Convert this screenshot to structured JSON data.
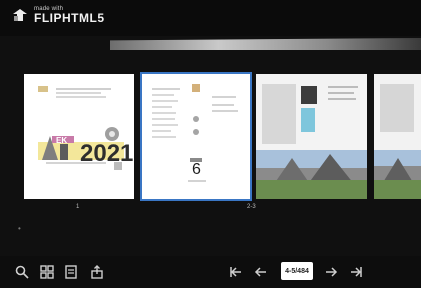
{
  "brand": {
    "small": "made with",
    "big": "FLIPHTML5"
  },
  "pages": {
    "page1_year": "2021",
    "page1_banner": "EK",
    "page1_caption": "1",
    "page23_caption": "2-3"
  },
  "toolbar": {
    "page_indicator": "4-5/484",
    "items": [
      "zoom-icon",
      "grid-icon",
      "thumbnails-icon",
      "share-icon",
      "first-page-icon",
      "previous-page-icon",
      "next-page-icon",
      "last-page-icon"
    ]
  }
}
